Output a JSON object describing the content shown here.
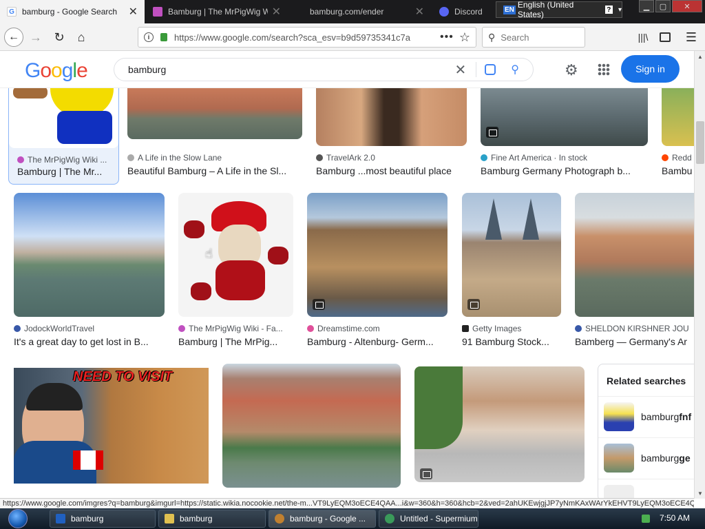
{
  "browser": {
    "tabs": [
      {
        "title": "bamburg - Google Search",
        "active": true,
        "icon": "google-g-icon"
      },
      {
        "title": "Bamburg | The MrPigWig Wiki",
        "active": false,
        "icon": "wiki-icon"
      },
      {
        "title": "bamburg.com/ender",
        "active": false,
        "icon": ""
      },
      {
        "title": "Discord",
        "active": false,
        "icon": "discord-icon"
      }
    ],
    "language": {
      "code": "EN",
      "label": "English (United States)",
      "help": "?"
    },
    "url": "https://www.google.com/search?sca_esv=b9d59735341c7a",
    "search_placeholder": "Search"
  },
  "google": {
    "logo": "Google",
    "query": "bamburg",
    "signin_label": "Sign in"
  },
  "results": {
    "row1": [
      {
        "source": "The MrPigWig Wiki ...",
        "title": "Bamburg | The Mr..."
      },
      {
        "source": "A Life in the Slow Lane",
        "title": "Beautiful Bamburg – A Life in the Sl..."
      },
      {
        "source": "TravelArk 2.0",
        "title": "Bamburg ...most beautiful place"
      },
      {
        "source": "Fine Art America · In stock",
        "title": "Bamburg Germany Photograph b..."
      },
      {
        "source": "Redd",
        "title": "Bambu"
      }
    ],
    "row2": [
      {
        "source": "JodockWorldTravel",
        "title": "It's a great day to get lost in B..."
      },
      {
        "source": "The MrPigWig Wiki - Fa...",
        "title": "Bamburg | The MrPig..."
      },
      {
        "source": "Dreamstime.com",
        "title": "Bamburg - Altenburg- Germ..."
      },
      {
        "source": "Getty Images",
        "title": "91 Bamburg Stock..."
      },
      {
        "source": "SHELDON KIRSHNER JOU",
        "title": "Bamberg — Germany's Ar"
      }
    ],
    "row3_overlay": "NEED TO VISIT",
    "related": {
      "heading": "Related searches",
      "items": [
        {
          "prefix": "bamburg ",
          "bold": "fnf"
        },
        {
          "prefix": "bamburg ",
          "bold": "ge"
        }
      ]
    }
  },
  "status_text": "https://www.google.com/imgres?q=bamburg&imgurl=https://static.wikia.nocookie.net/the-m...VT9LyEQM3oECE4QAA...i&w=360&h=360&hcb=2&ved=2ahUKEwjgjJP7yNmKAxWArYkEHVT9LyEQM3oECE4QAA",
  "taskbar": {
    "buttons": [
      {
        "label": "bamburg"
      },
      {
        "label": "bamburg"
      },
      {
        "label": "bamburg - Google ..."
      },
      {
        "label": "Untitled - Supermium"
      }
    ],
    "clock": "7:50 AM"
  }
}
